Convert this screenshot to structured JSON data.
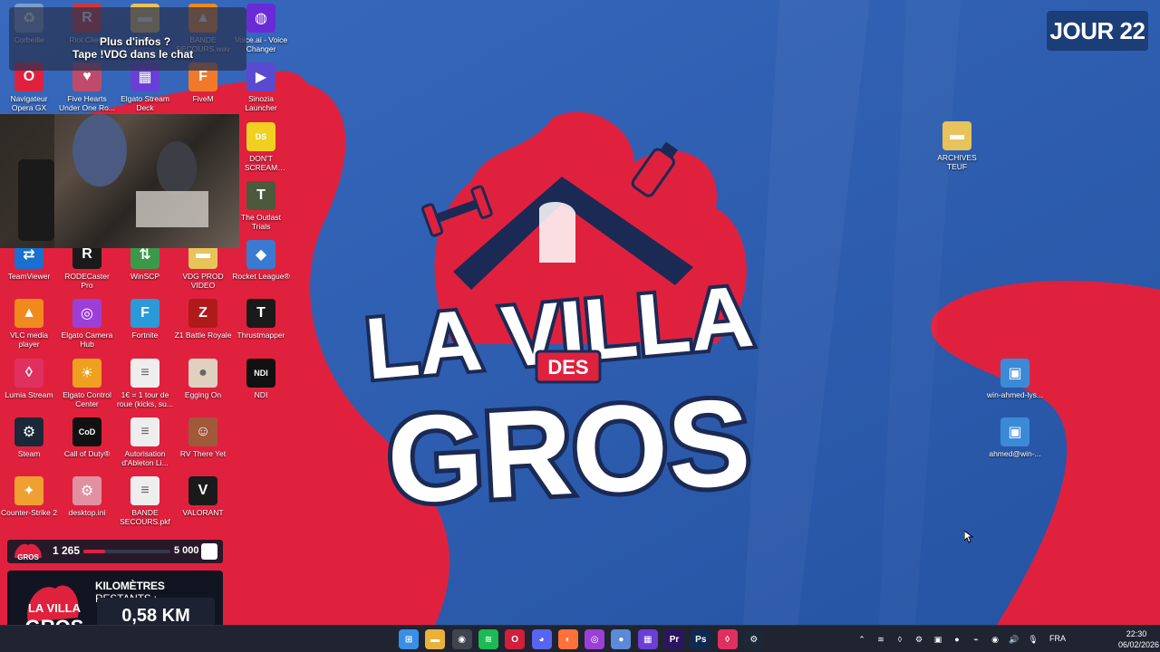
{
  "overlays": {
    "info_line1": "Plus d'infos ?",
    "info_line2": "Tape !VDG dans le chat",
    "day_badge": "JOUR 22",
    "goal": {
      "current": "1 265",
      "target": "5 000",
      "progress": 0.253
    },
    "km": {
      "label_bold": "KILOMÈTRES",
      "label_thin": "RESTANTS :",
      "value": "0,58 KM"
    },
    "mini_logo_line1": "LA VILLA",
    "mini_logo_line2": "GROS"
  },
  "wallpaper": {
    "logo_line1": "LA VILLA",
    "logo_line2": "DES",
    "logo_line3": "GROS",
    "colors": {
      "blue": "#2c5aa8",
      "red": "#e0213e",
      "dark": "#1b2a55"
    }
  },
  "desktop_icons": [
    {
      "label": "Corbeille",
      "icon": "recycle-bin-icon"
    },
    {
      "label": "Riot Client",
      "icon": "riot-icon"
    },
    {
      "label": "LAB",
      "icon": "folder-icon"
    },
    {
      "label": "BANDE SECOURS.wav",
      "icon": "vlc-icon"
    },
    {
      "label": "Voice.ai - Voice Changer",
      "icon": "voiceai-icon"
    },
    {
      "label": "Navigateur Opera GX",
      "icon": "opera-gx-icon"
    },
    {
      "label": "Five Hearts Under One Ro...",
      "icon": "five-hearts-icon"
    },
    {
      "label": "Elgato Stream Deck",
      "icon": "stream-deck-icon"
    },
    {
      "label": "FiveM",
      "icon": "fivem-icon"
    },
    {
      "label": "Sinozia Launcher",
      "icon": "sinozia-icon"
    },
    {
      "label": "DON'T SCREAM TOGETHER",
      "icon": "dont-scream-icon"
    },
    {
      "label": "The Outlast Trials",
      "icon": "outlast-icon"
    },
    {
      "label": "TeamViewer",
      "icon": "teamviewer-icon"
    },
    {
      "label": "RODECaster Pro",
      "icon": "rodecaster-icon"
    },
    {
      "label": "WinSCP",
      "icon": "winscp-icon"
    },
    {
      "label": "VDG PROD VIDEO",
      "icon": "folder-icon"
    },
    {
      "label": "Rocket League®",
      "icon": "rocket-league-icon"
    },
    {
      "label": "VLC media player",
      "icon": "vlc-icon"
    },
    {
      "label": "Elgato Camera Hub",
      "icon": "camera-hub-icon"
    },
    {
      "label": "Fortnite",
      "icon": "fortnite-icon"
    },
    {
      "label": "Z1 Battle Royale",
      "icon": "z1-icon"
    },
    {
      "label": "Thrustmapper",
      "icon": "thrustmapper-icon"
    },
    {
      "label": "Lumia Stream",
      "icon": "lumia-icon"
    },
    {
      "label": "Elgato Control Center",
      "icon": "control-center-icon"
    },
    {
      "label": "1€ = 1 tour de roue (kicks, su...",
      "icon": "text-file-icon"
    },
    {
      "label": "Egging On",
      "icon": "egg-icon"
    },
    {
      "label": "NDI",
      "icon": "ndi-icon"
    },
    {
      "label": "Steam",
      "icon": "steam-icon"
    },
    {
      "label": "Call of Duty®",
      "icon": "cod-icon"
    },
    {
      "label": "Autorisation d'Ableton Li...",
      "icon": "text-file-icon"
    },
    {
      "label": "RV There Yet",
      "icon": "rv-icon"
    },
    {
      "label": "Counter-Strike 2",
      "icon": "cs2-icon"
    },
    {
      "label": "desktop.ini",
      "icon": "ini-file-icon"
    },
    {
      "label": "BANDE SECOURS.pkf",
      "icon": "text-file-icon"
    },
    {
      "label": "VALORANT",
      "icon": "valorant-icon"
    },
    {
      "label": "ARCHIVES TEUF",
      "icon": "folder-icon"
    },
    {
      "label": "win-ahmed-lys...",
      "icon": "remote-desktop-icon"
    },
    {
      "label": "ahmed@win-...",
      "icon": "remote-desktop-icon"
    }
  ],
  "taskbar": {
    "apps": [
      {
        "name": "start-button-icon",
        "char": "⊞",
        "color": "#3a8ee6"
      },
      {
        "name": "file-explorer-icon",
        "char": "▬",
        "color": "#e8b23a"
      },
      {
        "name": "obs-icon",
        "char": "◉",
        "color": "#40444f"
      },
      {
        "name": "spotify-icon",
        "char": "≋",
        "color": "#1db954"
      },
      {
        "name": "opera-icon",
        "char": "O",
        "color": "#d01e3b"
      },
      {
        "name": "discord-icon",
        "char": "◕",
        "color": "#5865f2"
      },
      {
        "name": "firefox-icon",
        "char": "◐",
        "color": "#ff7139"
      },
      {
        "name": "camera-hub-icon",
        "char": "◎",
        "color": "#9b3fd6"
      },
      {
        "name": "browser-icon",
        "char": "●",
        "color": "#5a8ad8"
      },
      {
        "name": "stream-deck-icon",
        "char": "▦",
        "color": "#6a3fd6"
      },
      {
        "name": "premiere-icon",
        "char": "Pr",
        "color": "#2a1660"
      },
      {
        "name": "photoshop-icon",
        "char": "Ps",
        "color": "#0e2a50"
      },
      {
        "name": "lumia-icon",
        "char": "◊",
        "color": "#e03060"
      },
      {
        "name": "steam-icon",
        "char": "⚙",
        "color": "#1b2838"
      }
    ],
    "tray": [
      "chevron-up-icon",
      "spotify-tray-icon",
      "lumia-tray-icon",
      "steam-tray-icon",
      "rodecaster-tray-icon",
      "browser-tray-icon",
      "usb-tray-icon",
      "chrome-tray-icon",
      "speaker-icon",
      "microphone-icon"
    ],
    "language": "FRA",
    "time": "22:30",
    "date": "06/02/2026"
  }
}
